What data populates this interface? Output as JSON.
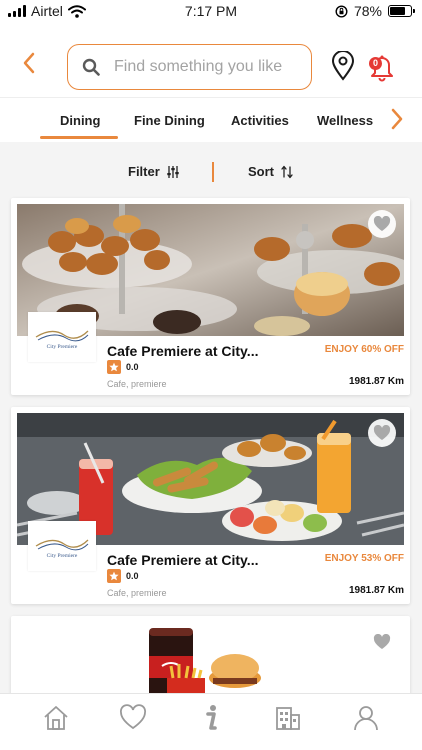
{
  "status_bar": {
    "carrier": "Airtel",
    "time": "7:17 PM",
    "battery": "78%",
    "battery_level": 0.78
  },
  "header": {
    "back_icon": "chevron-left-icon",
    "search_icon": "search-icon",
    "search_placeholder": "Find something you like",
    "location_icon": "location-pin-icon",
    "bell_icon": "bell-icon",
    "notification_count": "0"
  },
  "tabs": {
    "items": [
      {
        "label": "Dining",
        "active": true
      },
      {
        "label": "Fine Dining",
        "active": false
      },
      {
        "label": "Activities",
        "active": false
      },
      {
        "label": "Wellness",
        "active": false
      }
    ],
    "next_icon": "chevron-right-icon"
  },
  "filters": {
    "filter_label": "Filter",
    "sort_label": "Sort"
  },
  "listings": [
    {
      "name": "Cafe Premiere at City...",
      "rating": "0.0",
      "tags": "Cafe, premiere",
      "discount": "ENJOY 60% OFF",
      "distance": "1981.87 Km",
      "logo_text": "City Premiere"
    },
    {
      "name": "Cafe Premiere at City...",
      "rating": "0.0",
      "tags": "Cafe, premiere",
      "discount": "ENJOY 53% OFF",
      "distance": "1981.87 Km",
      "logo_text": "City Premiere"
    }
  ],
  "bottom_nav": {
    "items": [
      "home-icon",
      "heart-icon",
      "info-icon",
      "building-icon",
      "user-icon"
    ]
  },
  "colors": {
    "accent": "#e9883d",
    "badge": "#e53935"
  }
}
